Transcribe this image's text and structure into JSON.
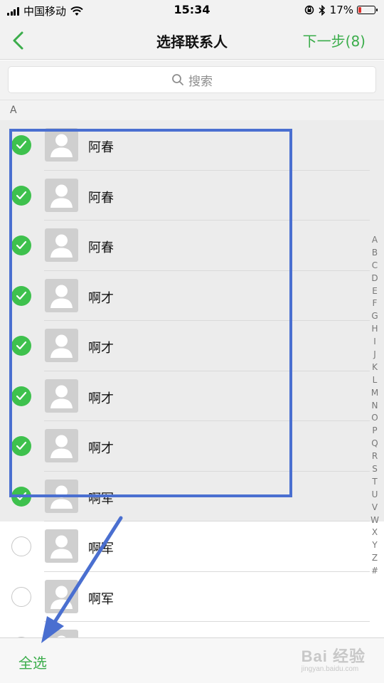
{
  "status_bar": {
    "carrier": "中国移动",
    "time": "15:34",
    "battery": "17%",
    "battery_level": 0.17,
    "battery_color": "#e0302b"
  },
  "nav": {
    "back_icon": "chevron-left-icon",
    "title": "选择联系人",
    "next_label": "下一步(8)",
    "accent": "#3bad4b"
  },
  "search": {
    "icon": "search-icon",
    "placeholder": "搜索"
  },
  "section_letter": "A",
  "contacts": [
    {
      "name": "阿春",
      "selected": true
    },
    {
      "name": "阿春",
      "selected": true
    },
    {
      "name": "阿春",
      "selected": true
    },
    {
      "name": "啊才",
      "selected": true
    },
    {
      "name": "啊才",
      "selected": true
    },
    {
      "name": "啊才",
      "selected": true
    },
    {
      "name": "啊才",
      "selected": true
    },
    {
      "name": "啊军",
      "selected": true
    },
    {
      "name": "啊军",
      "selected": false
    },
    {
      "name": "啊军",
      "selected": false
    },
    {
      "name": "",
      "selected": false
    }
  ],
  "index_letters": [
    "A",
    "B",
    "C",
    "D",
    "E",
    "F",
    "G",
    "H",
    "I",
    "J",
    "K",
    "L",
    "M",
    "N",
    "O",
    "P",
    "Q",
    "R",
    "S",
    "T",
    "U",
    "V",
    "W",
    "X",
    "Y",
    "Z",
    "#"
  ],
  "toolbar": {
    "select_all_label": "全选"
  },
  "watermark": {
    "line1": "Bai 经验",
    "line2": "jingyan.baidu.com"
  },
  "annotation_color": "#4a6fd0"
}
